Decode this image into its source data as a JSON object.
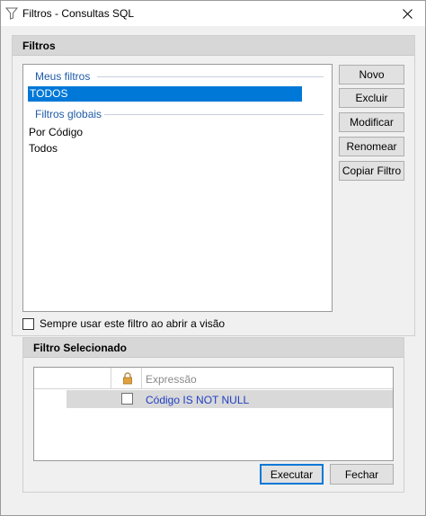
{
  "window": {
    "title": "Filtros - Consultas SQL"
  },
  "filtros_group": {
    "header": "Filtros",
    "my_filters_title": "Meus filtros",
    "my_filters": [
      "TODOS"
    ],
    "global_filters_title": "Filtros globais",
    "global_filters": [
      "Por Código",
      "Todos"
    ]
  },
  "buttons": {
    "novo": "Novo",
    "excluir": "Excluir",
    "modificar": "Modificar",
    "renomear": "Renomear",
    "copiar": "Copiar Filtro",
    "executar": "Executar",
    "fechar": "Fechar"
  },
  "options": {
    "always_use_label": "Sempre usar este filtro ao abrir a visão",
    "always_use_checked": false
  },
  "selected_filter_group": {
    "header": "Filtro Selecionado",
    "column_expression": "Expressão",
    "rows": [
      {
        "locked": false,
        "expression": "Código IS NOT NULL"
      }
    ]
  },
  "colors": {
    "selection": "#0078d7",
    "group_title": "#1e5aa8",
    "expression_text": "#1f3ec4"
  }
}
